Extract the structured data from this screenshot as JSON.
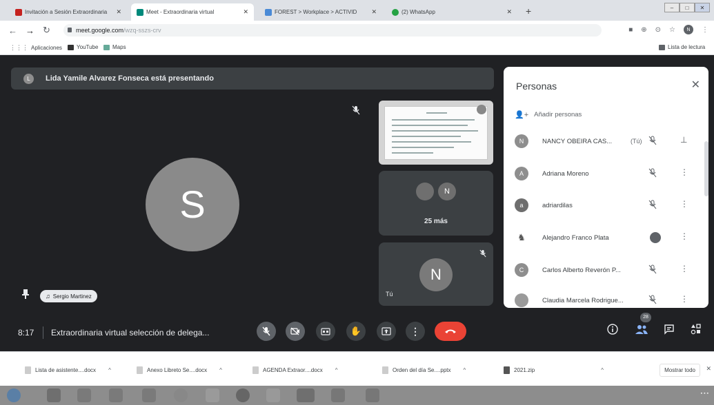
{
  "browser": {
    "tabs": [
      {
        "title": "Invitación a Sesión Extraordinaria",
        "active": false
      },
      {
        "title": "Meet - Extraordinaria virtual",
        "active": true
      },
      {
        "title": "FOREST > Workplace > ACTIVID",
        "active": false
      },
      {
        "title": "(2) WhatsApp",
        "active": false
      }
    ],
    "url_host": "meet.google.com",
    "url_path": "/wzq-sszs-crv",
    "bookmarks": [
      {
        "label": "Aplicaciones"
      },
      {
        "label": "YouTube"
      },
      {
        "label": "Maps"
      }
    ],
    "reading_list": "Lista de lectura"
  },
  "meet": {
    "presenting_banner": "Lida Yamile Alvarez Fonseca está presentando",
    "main_avatar_letter": "S",
    "speaker_name": "Sergio Martinez",
    "tile2_avatar_letter": "N",
    "tile2_more": "25 más",
    "self_avatar_letter": "N",
    "self_label": "Tú",
    "time": "8:17",
    "meeting_title": "Extraordinaria virtual selección de delega...",
    "participant_count": "28"
  },
  "people_panel": {
    "title": "Personas",
    "add_people": "Añadir personas",
    "people": [
      {
        "initial": "N",
        "name": "NANCY OBEIRA CAS...",
        "tag": "(Tú)",
        "color": "#8e8e8e"
      },
      {
        "initial": "A",
        "name": "Adriana Moreno",
        "tag": "",
        "color": "#8e8e8e"
      },
      {
        "initial": "a",
        "name": "adriardilas",
        "tag": "",
        "color": "#6e6e6e"
      },
      {
        "initial": "",
        "name": "Alejandro Franco Plata",
        "tag": "",
        "color": "#9a9a9a"
      },
      {
        "initial": "C",
        "name": "Carlos Alberto Reverón P...",
        "tag": "",
        "color": "#8e8e8e"
      },
      {
        "initial": "",
        "name": "Claudia Marcela Rodrigue...",
        "tag": "",
        "color": "#9a9a9a"
      }
    ]
  },
  "downloads": {
    "items": [
      {
        "name": "Lista de asistente....docx"
      },
      {
        "name": "Anexo Libreto Se....docx"
      },
      {
        "name": "AGENDA Extraor....docx"
      },
      {
        "name": "Orden del día Se....pptx"
      },
      {
        "name": "2021.zip"
      }
    ],
    "show_all": "Mostrar todo"
  }
}
